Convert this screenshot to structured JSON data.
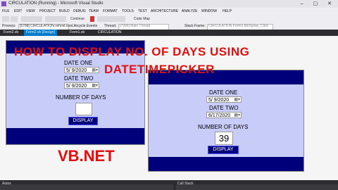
{
  "window": {
    "title": "CIRCULATION (Running) - Microsoft Visual Studio",
    "controls": "–  ▢  ✕"
  },
  "menu": [
    "FILE",
    "EDIT",
    "VIEW",
    "PROJECT",
    "BUILD",
    "DEBUG",
    "TEAM",
    "FORMAT",
    "TOOLS",
    "TEST",
    "ARCHITECTURE",
    "ANALYZE",
    "WINDOW",
    "HELP"
  ],
  "toolbar": {
    "continue_label": "Continue",
    "code_map_label": "Code Map"
  },
  "process_bar": {
    "process_label": "Process:",
    "process_value": "[5788] CIRCULATION.vshost.exe",
    "lifecycle_label": "Lifecycle Events",
    "thread_label": "Thread:",
    "thread_value": "[7996] Main Thread",
    "stack_label": "Stack Frame:",
    "stack_value": "CIRCULATION.Form2.btDisplay_Click"
  },
  "tabs": [
    {
      "label": "Form2.vb",
      "active": false
    },
    {
      "label": "Form2.vb [Design]",
      "active": true
    },
    {
      "label": "Form1.vb",
      "active": false
    },
    {
      "label": "CIRCULATION",
      "active": false
    }
  ],
  "headline": {
    "line1": "HOW TO DISPLAY NO. OF DAYS USING",
    "line2": "DATETIMEPICKER",
    "footer": "VB.NET"
  },
  "design_form": {
    "date_one_label": "DATE ONE",
    "date_one_value": "5/  9/2020",
    "date_two_label": "DATE TWO",
    "date_two_value": "5/  9/2020",
    "days_label": "NUMBER OF DAYS",
    "days_value": "",
    "display_button": "DISPLAY"
  },
  "running_form": {
    "date_one_label": "DATE ONE",
    "date_one_value": "5/  9/2020",
    "date_two_label": "DATE TWO",
    "date_two_value": "6/17/2020",
    "days_label": "NUMBER OF DAYS",
    "days_value": "39",
    "display_button": "DISPLAY"
  },
  "bottom": {
    "autos_label": "Autos",
    "callstack_label": "Call Stack"
  },
  "colors": {
    "form_body": "#c8ccf8",
    "form_strip": "#00007a",
    "headline": "#e01010",
    "tab_active": "#007acc"
  }
}
